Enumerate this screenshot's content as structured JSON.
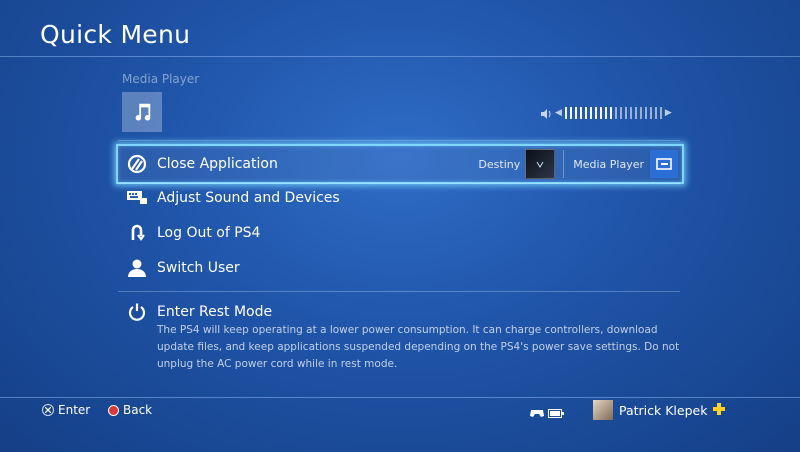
{
  "header": {
    "title": "Quick Menu"
  },
  "media": {
    "label": "Media Player",
    "icon": "music-note-icon",
    "volume_level": 0.5
  },
  "menu": {
    "close_app": {
      "label": "Close Application",
      "apps": [
        {
          "name": "Destiny",
          "icon": "destiny-thumbnail"
        },
        {
          "name": "Media Player",
          "icon": "media-player-icon"
        }
      ]
    },
    "adjust_sound": {
      "label": "Adjust Sound and Devices"
    },
    "log_out": {
      "label": "Log Out of PS4"
    },
    "switch_user": {
      "label": "Switch User"
    },
    "rest_mode": {
      "label": "Enter Rest Mode",
      "description": "The PS4 will keep operating at a lower power consumption. It can charge controllers, download update files, and keep applications suspended depending on the PS4's power save settings. Do not unplug the AC power cord while in rest mode."
    }
  },
  "footer": {
    "enter_label": "Enter",
    "back_label": "Back",
    "user_name": "Patrick Klepek"
  },
  "colors": {
    "highlight": "#7fd6ff",
    "back_button": "#d63a3a",
    "plus_badge": "#ffd21f"
  }
}
